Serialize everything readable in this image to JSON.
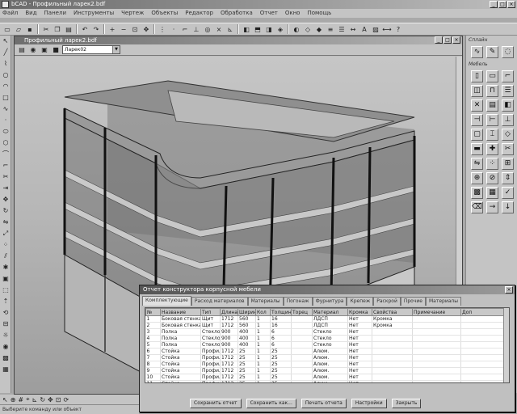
{
  "app": {
    "title": "bCAD - Профильный ларек2.bdf",
    "window_buttons": [
      "_",
      "□",
      "×"
    ]
  },
  "menu": [
    "Файл",
    "Вид",
    "Панели",
    "Инструменты",
    "Чертеж",
    "Объекты",
    "Редактор",
    "Обработка",
    "Отчет",
    "Окно",
    "Помощь"
  ],
  "document": {
    "title": "Профильный ларек2.bdf",
    "layer_value": "Ларек02"
  },
  "right_panel": {
    "section1_title": "Сплайн",
    "section2_title": "Мебель"
  },
  "report": {
    "title": "Отчет конструктора корпусной мебели",
    "tabs": [
      "Комплектующие",
      "Расход материалов",
      "Материалы",
      "Погонаж",
      "Фурнитура",
      "Крепеж",
      "Раскрой",
      "Прочие",
      "Материалы"
    ],
    "columns": [
      "№",
      "Название",
      "Тип",
      "Длина",
      "Ширина",
      "Кол",
      "Толщина",
      "Торец",
      "Материал",
      "Кромка",
      "Свойства",
      "Примечание",
      "Доп"
    ],
    "rows": [
      [
        "1",
        "Боковая стенка",
        "Щит",
        "1712",
        "560",
        "1",
        "16",
        "",
        "ЛДСП",
        "Нет",
        "Кромка",
        "",
        ""
      ],
      [
        "2",
        "Боковая стенка",
        "Щит",
        "1712",
        "560",
        "1",
        "16",
        "",
        "ЛДСП",
        "Нет",
        "Кромка",
        "",
        ""
      ],
      [
        "3",
        "Полка",
        "Стекло",
        "900",
        "400",
        "1",
        "6",
        "",
        "Стекло",
        "Нет",
        "",
        "",
        ""
      ],
      [
        "4",
        "Полка",
        "Стекло",
        "900",
        "400",
        "1",
        "6",
        "",
        "Стекло",
        "Нет",
        "",
        "",
        ""
      ],
      [
        "5",
        "Полка",
        "Стекло",
        "900",
        "400",
        "1",
        "6",
        "",
        "Стекло",
        "Нет",
        "",
        "",
        ""
      ],
      [
        "6",
        "Стойка",
        "Профиль",
        "1712",
        "25",
        "1",
        "25",
        "",
        "Алюм.",
        "Нет",
        "",
        "",
        ""
      ],
      [
        "7",
        "Стойка",
        "Профиль",
        "1712",
        "25",
        "1",
        "25",
        "",
        "Алюм.",
        "Нет",
        "",
        "",
        ""
      ],
      [
        "8",
        "Стойка",
        "Профиль",
        "1712",
        "25",
        "1",
        "25",
        "",
        "Алюм.",
        "Нет",
        "",
        "",
        ""
      ],
      [
        "9",
        "Стойка",
        "Профиль",
        "1712",
        "25",
        "1",
        "25",
        "",
        "Алюм.",
        "Нет",
        "",
        "",
        ""
      ],
      [
        "10",
        "Стойка",
        "Профиль",
        "1712",
        "25",
        "1",
        "25",
        "",
        "Алюм.",
        "Нет",
        "",
        "",
        ""
      ],
      [
        "11",
        "Стойка",
        "Профиль",
        "1712",
        "25",
        "1",
        "25",
        "",
        "Алюм.",
        "Нет",
        "",
        "",
        ""
      ],
      [
        "12",
        "Стойка",
        "Профиль",
        "1712",
        "25",
        "1",
        "25",
        "",
        "Алюм.",
        "Нет",
        "",
        "",
        ""
      ]
    ],
    "buttons": [
      "Сохранить отчет",
      "Сохранить как...",
      "Печать отчета",
      "Настройки",
      "Закрыть"
    ]
  },
  "status": {
    "text": "Выберите команду или объект"
  }
}
